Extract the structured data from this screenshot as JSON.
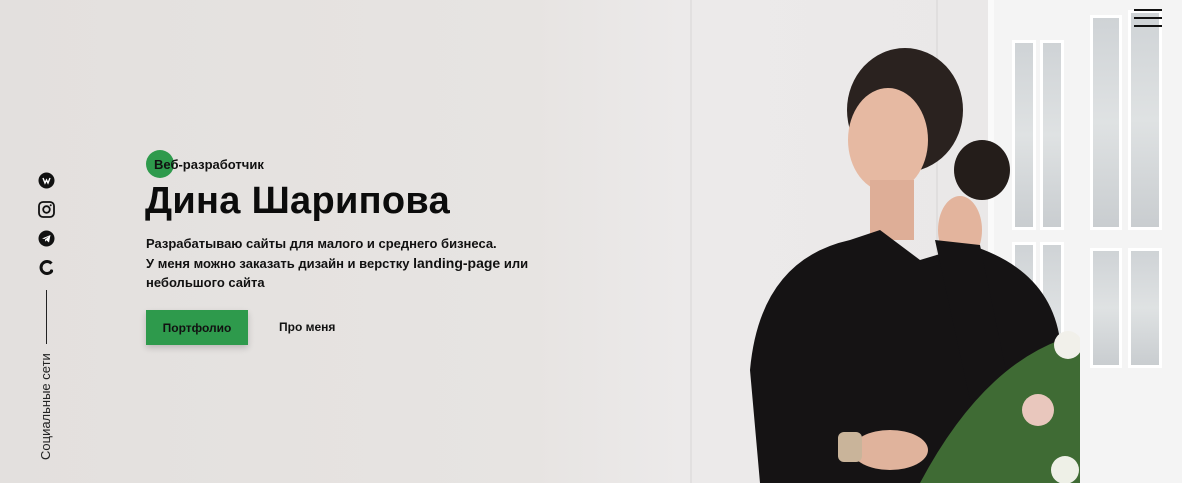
{
  "header": {
    "menu_icon": "hamburger-icon"
  },
  "social": {
    "icons": [
      "vk-icon",
      "instagram-icon",
      "telegram-icon",
      "behance-icon"
    ],
    "label": "Социальные сети"
  },
  "hero": {
    "badge": "Веб-разработчик",
    "title": "Дина Шарипова",
    "description_line1": "Разрабатываю сайты для малого и среднего бизнеса.",
    "description_line2_prefix": "У меня можно заказать дизайн и верстку ",
    "description_line2_strong": "landing-page",
    "description_line2_suffix": " или",
    "description_line3": "небольшого сайта",
    "primary_button": "Портфолио",
    "secondary_link": "Про меня"
  },
  "colors": {
    "accent": "#2e9a4c",
    "text": "#111111",
    "background": "#e6e3e1"
  }
}
